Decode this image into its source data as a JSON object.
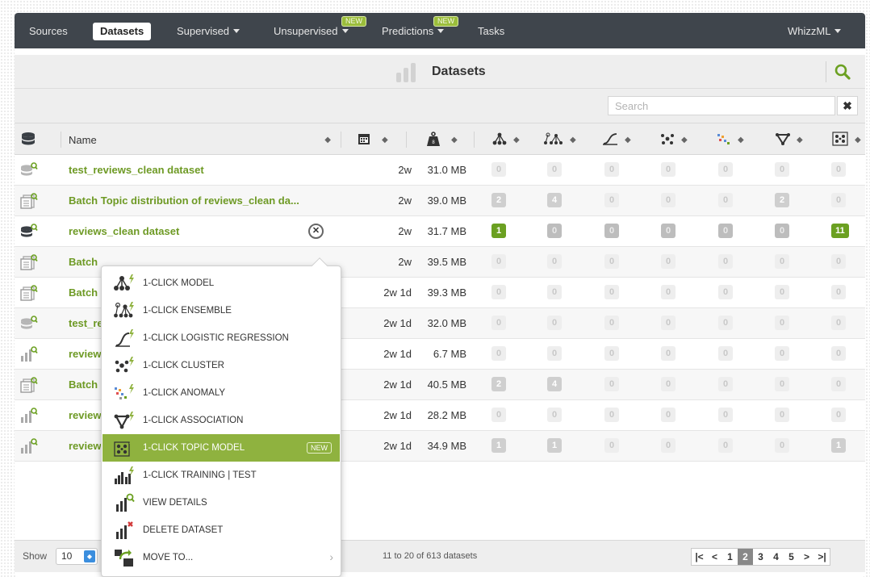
{
  "nav": {
    "items": [
      {
        "label": "Sources",
        "active": false,
        "dropdown": false
      },
      {
        "label": "Datasets",
        "active": true,
        "dropdown": false
      },
      {
        "label": "Supervised",
        "active": false,
        "dropdown": true
      },
      {
        "label": "Unsupervised",
        "active": false,
        "dropdown": true,
        "badge": "NEW"
      },
      {
        "label": "Predictions",
        "active": false,
        "dropdown": true,
        "badge": "NEW"
      },
      {
        "label": "Tasks",
        "active": false,
        "dropdown": false
      }
    ],
    "right_label": "WhizzML"
  },
  "title": "Datasets",
  "search": {
    "placeholder": "Search",
    "clear_icon": "close-icon"
  },
  "columns": {
    "name": "Name",
    "icons": [
      "database-icon",
      "calendar-icon",
      "weight-icon",
      "model-icon",
      "ensemble-icon",
      "logistic-regression-icon",
      "cluster-icon",
      "anomaly-icon",
      "association-icon",
      "topic-model-icon"
    ]
  },
  "rows": [
    {
      "name": "test_reviews_clean dataset",
      "age": "2w",
      "size": "31.0 MB",
      "icon": "dataset-icon",
      "counts": [
        "0",
        "0",
        "0",
        "0",
        "0",
        "0",
        "0"
      ]
    },
    {
      "name": "Batch Topic distribution of reviews_clean da...",
      "age": "2w",
      "size": "39.0 MB",
      "icon": "batch-icon",
      "counts": [
        "2",
        "4",
        "0",
        "0",
        "0",
        "2",
        "0"
      ]
    },
    {
      "name": "reviews_clean dataset",
      "age": "2w",
      "size": "31.7 MB",
      "icon": "dataset-icon",
      "counts": [
        "1",
        "0",
        "0",
        "0",
        "0",
        "0",
        "11"
      ]
    },
    {
      "name": "Batch",
      "age": "2w",
      "size": "39.5 MB",
      "icon": "batch-icon",
      "counts": [
        "0",
        "0",
        "0",
        "0",
        "0",
        "0",
        "0"
      ]
    },
    {
      "name": "Batch",
      "age": "2w 1d",
      "size": "39.3 MB",
      "icon": "batch-icon",
      "counts": [
        "0",
        "0",
        "0",
        "0",
        "0",
        "0",
        "0"
      ]
    },
    {
      "name": "test_re",
      "age": "2w 1d",
      "size": "32.0 MB",
      "icon": "dataset-icon",
      "counts": [
        "0",
        "0",
        "0",
        "0",
        "0",
        "0",
        "0"
      ]
    },
    {
      "name": "review",
      "age": "2w 1d",
      "size": "6.7 MB",
      "icon": "sample-icon",
      "counts": [
        "0",
        "0",
        "0",
        "0",
        "0",
        "0",
        "0"
      ]
    },
    {
      "name": "Batch",
      "age": "2w 1d",
      "size": "40.5 MB",
      "icon": "batch-icon",
      "counts": [
        "2",
        "4",
        "0",
        "0",
        "0",
        "0",
        "0"
      ]
    },
    {
      "name": "review",
      "age": "2w 1d",
      "size": "28.2 MB",
      "icon": "sample-icon",
      "counts": [
        "0",
        "0",
        "0",
        "0",
        "0",
        "0",
        "0"
      ]
    },
    {
      "name": "review",
      "age": "2w 1d",
      "size": "34.9 MB",
      "icon": "sample-icon",
      "counts": [
        "1",
        "1",
        "0",
        "0",
        "0",
        "0",
        "1"
      ]
    }
  ],
  "menu": {
    "items": [
      {
        "label": "1-CLICK MODEL",
        "icon": "model-icon"
      },
      {
        "label": "1-CLICK ENSEMBLE",
        "icon": "ensemble-icon"
      },
      {
        "label": "1-CLICK LOGISTIC REGRESSION",
        "icon": "logistic-regression-icon"
      },
      {
        "label": "1-CLICK CLUSTER",
        "icon": "cluster-icon"
      },
      {
        "label": "1-CLICK ANOMALY",
        "icon": "anomaly-icon"
      },
      {
        "label": "1-CLICK ASSOCIATION",
        "icon": "association-icon"
      },
      {
        "label": "1-CLICK TOPIC MODEL",
        "icon": "topic-model-icon",
        "highlighted": true,
        "badge": "NEW"
      },
      {
        "label": "1-CLICK TRAINING | TEST",
        "icon": "training-test-icon"
      },
      {
        "label": "VIEW DETAILS",
        "icon": "view-details-icon"
      },
      {
        "label": "DELETE DATASET",
        "icon": "delete-icon"
      },
      {
        "label": "MOVE TO...",
        "icon": "move-to-icon",
        "submenu": true
      }
    ]
  },
  "footer": {
    "show_label": "Show",
    "show_value": "10",
    "count_text": "11 to 20 of 613 datasets",
    "pages": [
      "1",
      "2",
      "3",
      "4",
      "5"
    ],
    "current_page": "2"
  },
  "colors": {
    "nav": "#3f454c",
    "accent_green": "#6e9a25",
    "highlight": "#8fb23f"
  }
}
